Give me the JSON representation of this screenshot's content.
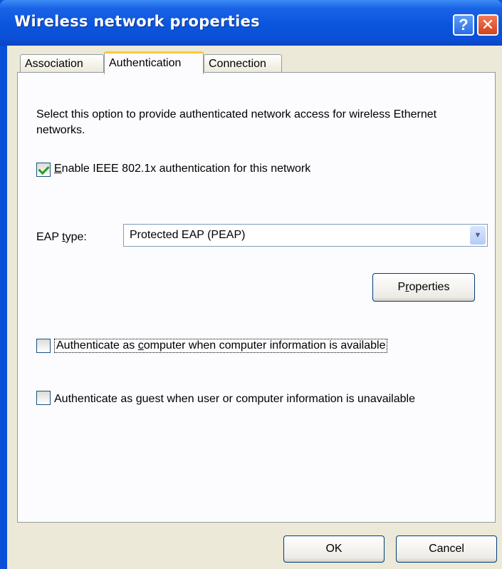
{
  "window": {
    "title": "Wireless network properties"
  },
  "tabs": [
    {
      "label": "Association",
      "active": false
    },
    {
      "label": "Authentication",
      "active": true
    },
    {
      "label": "Connection",
      "active": false
    }
  ],
  "auth": {
    "description": "Select this option to provide authenticated network access for wireless Ethernet networks.",
    "enable_8021x": {
      "mnemonic": "E",
      "label_rest": "nable IEEE 802.1x authentication for this network",
      "checked": true
    },
    "eap_type": {
      "label_pre": "EAP ",
      "mnemonic": "t",
      "label_post": "ype:",
      "value": "Protected EAP (PEAP)"
    },
    "properties_button": {
      "pre": "P",
      "mnemonic": "r",
      "post": "operties"
    },
    "auth_computer": {
      "pre": "Authenticate as ",
      "mnemonic": "c",
      "post": "omputer when computer information is available",
      "checked": false
    },
    "auth_guest": {
      "pre": "Authenticate as ",
      "mnemonic": "g",
      "post": "uest when user or computer information is unavailable",
      "checked": false
    }
  },
  "footer": {
    "ok_label": "OK",
    "cancel_label": "Cancel"
  },
  "colors": {
    "titlebar": "#0a55dd",
    "dialog_bg": "#ece9d8",
    "active_tab_accent": "#ffc83c",
    "checkmark": "#21a121"
  },
  "icons": {
    "help": "question-mark",
    "close": "x"
  }
}
